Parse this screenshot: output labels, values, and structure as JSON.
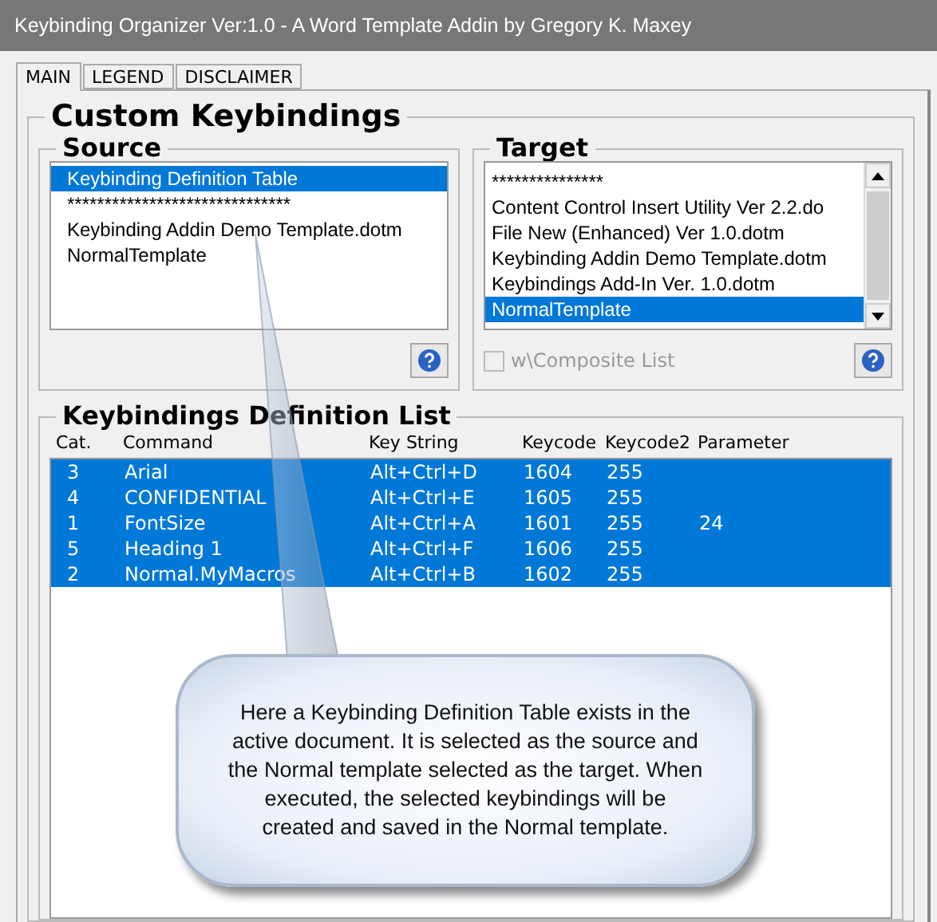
{
  "window": {
    "title": "Keybinding Organizer Ver:1.0 - A Word Template Addin by Gregory K. Maxey"
  },
  "tabs": [
    {
      "label": "MAIN",
      "selected": true
    },
    {
      "label": "LEGEND",
      "selected": false
    },
    {
      "label": "DISCLAIMER",
      "selected": false
    }
  ],
  "main": {
    "title": "Custom Keybindings",
    "source": {
      "title": "Source",
      "items": [
        {
          "label": "Keybinding Definition Table",
          "selected": true
        },
        {
          "label": "******************************",
          "selected": false
        },
        {
          "label": "Keybinding Addin Demo Template.dotm",
          "selected": false
        },
        {
          "label": "NormalTemplate",
          "selected": false
        }
      ]
    },
    "target": {
      "title": "Target",
      "items": [
        {
          "label": "***************",
          "selected": false
        },
        {
          "label": "Content Control Insert Utility Ver 2.2.do",
          "selected": false
        },
        {
          "label": "File New (Enhanced) Ver 1.0.dotm",
          "selected": false
        },
        {
          "label": "Keybinding Addin Demo Template.dotm",
          "selected": false
        },
        {
          "label": "Keybindings Add-In Ver. 1.0.dotm",
          "selected": false
        },
        {
          "label": "NormalTemplate",
          "selected": true
        }
      ],
      "composite": {
        "label": "w\\Composite List",
        "checked": false,
        "disabled": true
      }
    },
    "list": {
      "title": "Keybindings Definition List",
      "columns": [
        "Cat.",
        "Command",
        "Key String",
        "Keycode",
        "Keycode2",
        "Parameter"
      ],
      "rows": [
        {
          "cells": [
            "3",
            "Arial",
            "Alt+Ctrl+D",
            "1604",
            "255",
            ""
          ],
          "selected": true
        },
        {
          "cells": [
            "4",
            "CONFIDENTIAL",
            "Alt+Ctrl+E",
            "1605",
            "255",
            ""
          ],
          "selected": true
        },
        {
          "cells": [
            "1",
            "FontSize",
            "Alt+Ctrl+A",
            "1601",
            "255",
            "24"
          ],
          "selected": true
        },
        {
          "cells": [
            "5",
            "Heading 1",
            "Alt+Ctrl+F",
            "1606",
            "255",
            ""
          ],
          "selected": true
        },
        {
          "cells": [
            "2",
            "Normal.MyMacros",
            "Alt+Ctrl+B",
            "1602",
            "255",
            ""
          ],
          "selected": true
        }
      ]
    }
  },
  "callout": {
    "text": "Here a Keybinding Definition Table exists in the active document. It is selected as the source and the Normal template selected as the target.  When executed, the selected keybindings will be created and saved in the Normal template."
  }
}
